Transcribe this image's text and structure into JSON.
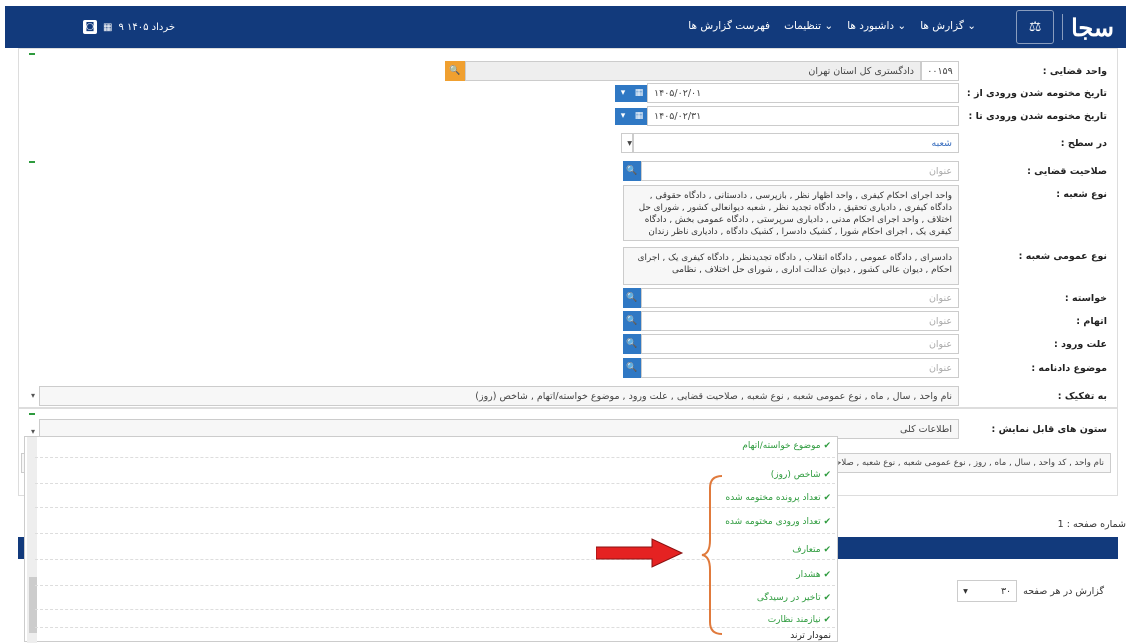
{
  "navbar": {
    "brand": "سجا",
    "logo_text": "⚖",
    "menu": [
      "گزارش ها",
      "داشبورد ها",
      "تنظیمات",
      "فهرست گزارش ها"
    ],
    "date": "۹ خرداد ۱۴۰۵",
    "rss": "RSS"
  },
  "form": {
    "unit": {
      "label": "واحد قضایی :",
      "code": "۰۰۱۵۹",
      "value": "دادگستری کل استان تهران"
    },
    "date_from": {
      "label": "تاریخ مختومه شدن ورودی از :",
      "value": "۱۴۰۵/۰۲/۰۱"
    },
    "date_to": {
      "label": "تاریخ مختومه شدن ورودی تا :",
      "value": "۱۴۰۵/۰۲/۳۱"
    },
    "level": {
      "label": "در سطح :",
      "value": "شعبه"
    },
    "jurisdiction": {
      "label": "صلاحیت قضایی :",
      "placeholder": "عنوان"
    },
    "branch_type": {
      "label": "نوع شعبه :",
      "value": "واحد اجرای احکام کیفری , واحد اظهار نظر , بازپرسی , دادستانی , دادگاه حقوقی , دادگاه کیفری , دادیاری تحقیق , دادگاه تجدید نظر , شعبه دیوانعالی کشور , شورای حل اختلاف , واحد اجرای احکام مدنی , دادیاری سرپرستی , دادگاه عمومی بخش , دادگاه کیفری یک , اجرای احکام شورا , کشیک دادسرا , کشیک دادگاه , دادیاری ناظر زندان"
    },
    "general_branch_type": {
      "label": "نوع عمومی شعبه :",
      "value": "دادسرای , دادگاه عمومی , دادگاه انقلاب , دادگاه تجدیدنظر , دادگاه کیفری یک , اجرای احکام , دیوان عالی کشور , دیوان عدالت اداری , شورای حل اختلاف , نظامی"
    },
    "claim": {
      "label": "خواسته :",
      "placeholder": "عنوان"
    },
    "accusation": {
      "label": "اتهام :",
      "placeholder": "عنوان"
    },
    "entry_reason": {
      "label": "علت ورود :",
      "placeholder": "عنوان"
    },
    "case_subject": {
      "label": "موضوع دادنامه :",
      "placeholder": "عنوان"
    },
    "breakdown": {
      "label": "به تفکیک :",
      "value": "نام واحد , سال , ماه , نوع عمومی شعبه , نوع شعبه , صلاحیت قضایی , علت ورود , موضوع خواسته/اتهام , شاخص (روز)"
    }
  },
  "columns": {
    "label": "ستون های قابل نمایش :",
    "preset": "اطلاعات کلی",
    "selected": "نام واحد , کد واحد , سال , ماه , روز , نوع عمومی شعبه , نوع شعبه , صلاحیت قضایی , علت ورود , خواسته/اتهام , موضوع خواسته/اتهام , شاخص (روز) , تعداد پرونده مختومه شده , تعداد ورودی مختومه شده , متعارف , هشدار , تاخیر در رسیدگی , نیازمند نظارت",
    "options": [
      "موضوع خواسته/اتهام",
      "شاخص (روز)",
      "تعداد پرونده مختومه شده",
      "تعداد ورودی مختومه شده",
      "متعارف",
      "هشدار",
      "تاخیر در رسیدگی",
      "نیازمند نظارت",
      "نمودار ترند"
    ]
  },
  "pager": {
    "page_label": "شماره صفحه : 1",
    "per_page_label": "گزارش در هر صفحه",
    "per_page": "۳۰"
  },
  "colors": {
    "navy": "#123a7c",
    "accent": "#2f78c4",
    "check": "#2e9b3e",
    "annotation_arrow": "#e52222",
    "annotation_brace": "#e07a3c"
  }
}
